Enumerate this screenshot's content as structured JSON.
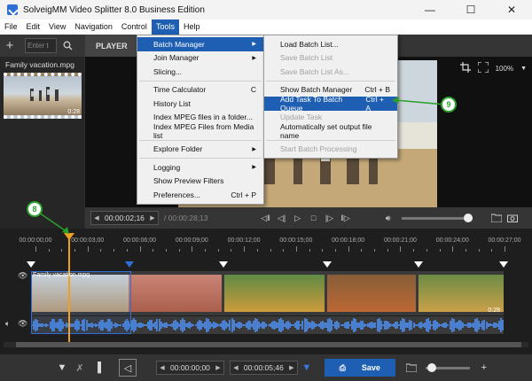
{
  "window": {
    "title": "SolveigMM Video Splitter 8.0 Business Edition",
    "minimize": "—",
    "maximize": "☐",
    "close": "✕"
  },
  "menubar": [
    "File",
    "Edit",
    "View",
    "Navigation",
    "Control",
    "Tools",
    "Help"
  ],
  "toolbar": {
    "search_placeholder": "Enter t",
    "player_tab": "PLAYER"
  },
  "media_list": {
    "file_name": "Family vacation.mpg",
    "duration": "0:28"
  },
  "preview": {
    "zoom": "100%"
  },
  "player_controls": {
    "current_time": "00:00:02;16",
    "total_time": "/ 00:00:28;13"
  },
  "timeline": {
    "ticks": [
      "00:00:00;00",
      "00:00:03;00",
      "00:00:06;00",
      "00:00:09;00",
      "00:00:12;00",
      "00:00:15;00",
      "00:00:18;00",
      "00:00:21;00",
      "00:00:24;00",
      "00:00:27;00"
    ],
    "clip_name": "Family vacation.mpg",
    "clip_duration": "0:28"
  },
  "bottom": {
    "start_time": "00:00:00;00",
    "end_time": "00:00:05;46",
    "save_label": "Save"
  },
  "tools_menu": [
    {
      "label": "Batch Manager",
      "shortcut": "",
      "sub": true,
      "highlight": true
    },
    {
      "label": "Join Manager",
      "shortcut": "",
      "sub": true
    },
    {
      "label": "Slicing...",
      "shortcut": ""
    },
    {
      "sep": true
    },
    {
      "label": "Time Calculator",
      "shortcut": "C"
    },
    {
      "label": "History List",
      "shortcut": ""
    },
    {
      "label": "Index MPEG files in a folder...",
      "shortcut": ""
    },
    {
      "label": "Index MPEG Files from Media list",
      "shortcut": ""
    },
    {
      "sep": true
    },
    {
      "label": "Explore Folder",
      "shortcut": "",
      "sub": true
    },
    {
      "sep": true
    },
    {
      "label": "Logging",
      "shortcut": "",
      "sub": true
    },
    {
      "label": "Show Preview Filters",
      "shortcut": ""
    },
    {
      "label": "Preferences...",
      "shortcut": "Ctrl + P"
    }
  ],
  "batch_menu": [
    {
      "label": "Load Batch List...",
      "shortcut": ""
    },
    {
      "label": "Save Batch List",
      "shortcut": "",
      "disabled": true
    },
    {
      "label": "Save Batch List As...",
      "shortcut": "",
      "disabled": true
    },
    {
      "sep": true
    },
    {
      "label": "Show Batch Manager",
      "shortcut": "Ctrl + B"
    },
    {
      "label": "Add Task To Batch Queue",
      "shortcut": "Ctrl + A",
      "highlight": true
    },
    {
      "label": "Update Task",
      "shortcut": "",
      "disabled": true
    },
    {
      "label": "Automatically set output file name",
      "shortcut": ""
    },
    {
      "sep": true
    },
    {
      "label": "Start Batch Processing",
      "shortcut": "",
      "disabled": true
    }
  ],
  "callouts": {
    "timeline_marker": "8",
    "batch_item": "9"
  },
  "colors": {
    "accent": "#1e5fb3",
    "playhead": "#f0a020",
    "callout": "#2aa02a",
    "waveform": "#4a7fd0"
  }
}
